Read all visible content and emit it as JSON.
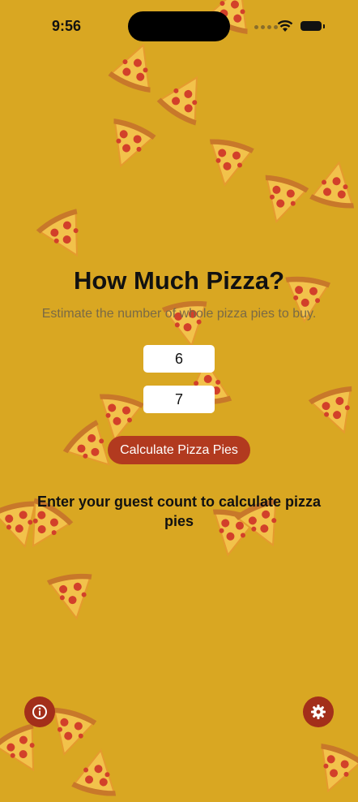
{
  "status_bar": {
    "time": "9:56"
  },
  "main": {
    "title": "How Much Pizza?",
    "subtitle": "Estimate the number of whole pizza pies to buy.",
    "guests_value": "6",
    "slices_value": "7",
    "calculate_label": "Calculate Pizza Pies",
    "result_text": "Enter your guest count to calculate pizza pies"
  },
  "icons": {
    "info": "info-icon",
    "settings": "gear-icon",
    "background": "pizza-slice-icon"
  },
  "colors": {
    "background": "#D9A722",
    "button": "#B23A1F",
    "round_button": "#A32F1A"
  }
}
